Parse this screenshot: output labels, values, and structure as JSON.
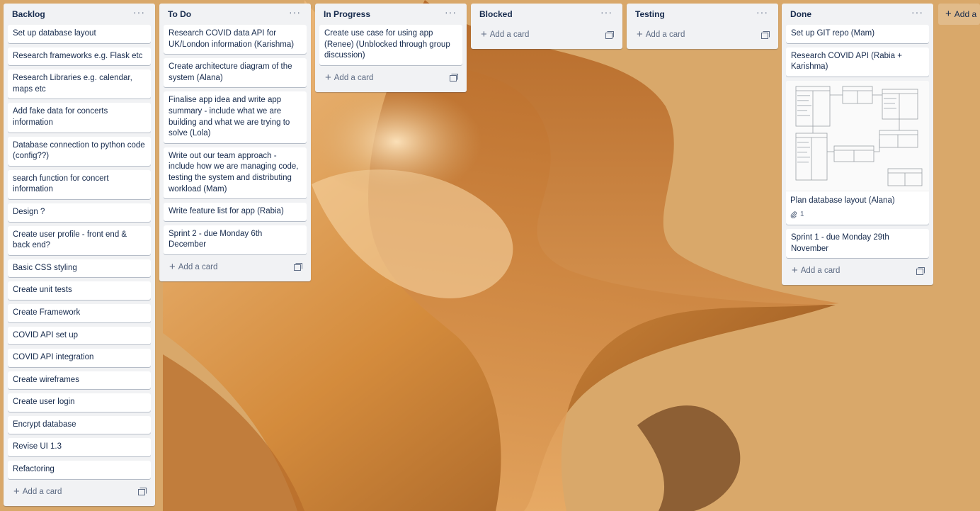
{
  "colors": {
    "background": "#d9a86a",
    "list": "#f1f2f4",
    "card": "#ffffff",
    "text": "#172b4d",
    "muted": "#5e6c84"
  },
  "icons": {
    "menu": "ellipsis-icon",
    "add": "plus-icon",
    "template": "card-template-icon",
    "attachment": "paperclip-icon"
  },
  "add_card_label": "Add a card",
  "add_list_label": "Add a",
  "lists": [
    {
      "title": "Backlog",
      "cards": [
        "Set up database layout",
        "Research frameworks e.g. Flask etc",
        "Research Libraries e.g. calendar, maps etc",
        "Add fake data for concerts information",
        "Database connection to python code (config??)",
        "search function for concert information",
        "Design ?",
        "Create user profile - front end & back end?",
        "Basic CSS styling",
        "Create unit tests",
        "Create Framework",
        "COVID API set up",
        "COVID API integration",
        "Create wireframes",
        "Create user login",
        "Encrypt database",
        "Revise UI 1.3",
        "Refactoring"
      ]
    },
    {
      "title": "To Do",
      "cards": [
        "Research COVID data API for UK/London information (Karishma)",
        "Create architecture diagram of the system (Alana)",
        "Finalise app idea and write app summary - include what we are building and what we are trying to solve (Lola)",
        "Write out our team approach - include how we are managing code, testing the system and distributing workload (Mam)",
        "Write feature list for app (Rabia)",
        "Sprint 2 - due Monday 6th December"
      ]
    },
    {
      "title": "In Progress",
      "cards": [
        "Create use case for using app (Renee) (Unblocked through group discussion)"
      ]
    },
    {
      "title": "Blocked",
      "cards": []
    },
    {
      "title": "Testing",
      "cards": []
    },
    {
      "title": "Done",
      "cards": [
        "Set up GIT repo (Mam)",
        "Research COVID API (Rabia + Karishma)",
        "Plan database layout (Alana)",
        "Sprint 1 - due Monday 29th November"
      ],
      "image_card_index": 2,
      "attachment_count": "1"
    }
  ]
}
